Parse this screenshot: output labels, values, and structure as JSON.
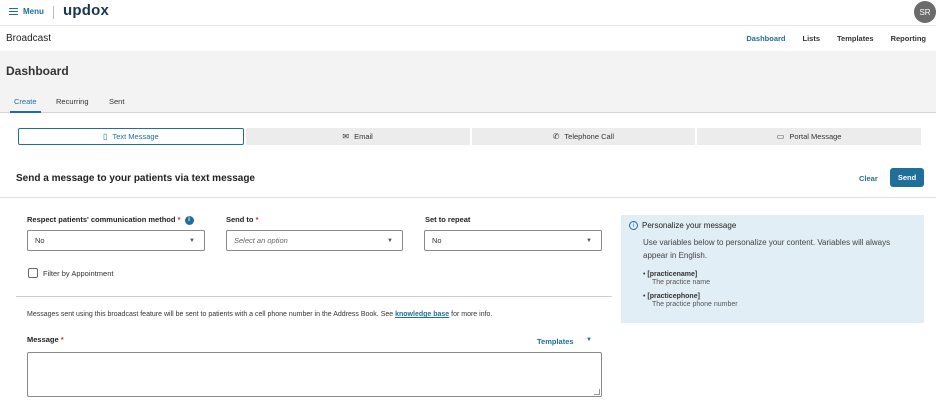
{
  "topbar": {
    "menu_label": "Menu",
    "logo": "updox",
    "avatar_initials": "SR"
  },
  "broadcast": {
    "title": "Broadcast",
    "nav": [
      "Dashboard",
      "Lists",
      "Templates",
      "Reporting"
    ],
    "active_nav": "Dashboard"
  },
  "page": {
    "title": "Dashboard"
  },
  "tabs": [
    "Create",
    "Recurring",
    "Sent"
  ],
  "channels": [
    {
      "label": "Text Message",
      "icon": "phone-icon"
    },
    {
      "label": "Email",
      "icon": "envelope-icon"
    },
    {
      "label": "Telephone Call",
      "icon": "handset-icon"
    },
    {
      "label": "Portal Message",
      "icon": "monitor-icon"
    }
  ],
  "form": {
    "heading": "Send a message to your patients via text message",
    "clear_label": "Clear",
    "send_label": "Send",
    "respect_label": "Respect patients' communication method",
    "respect_value": "No",
    "send_to_label": "Send to",
    "send_to_placeholder": "Select an option",
    "repeat_label": "Set to repeat",
    "repeat_value": "No",
    "filter_label": "Filter by Appointment",
    "note_before": "Messages sent using this broadcast feature will be sent to patients with a cell phone number in the Address Book. See ",
    "note_link": "knowledge base",
    "note_after": " for more info.",
    "message_label": "Message",
    "templates_label": "Templates",
    "required_mark": "*"
  },
  "personalize": {
    "title": "Personalize your message",
    "description": "Use variables below to personalize your content. Variables will always appear in English.",
    "variables": [
      {
        "name": "[practicename]",
        "desc": "The practice name"
      },
      {
        "name": "[practicephone]",
        "desc": "The practice phone number"
      }
    ]
  },
  "colors": {
    "accent": "#1f6f9a",
    "panel": "#e1eef6",
    "required": "#c0392b"
  }
}
